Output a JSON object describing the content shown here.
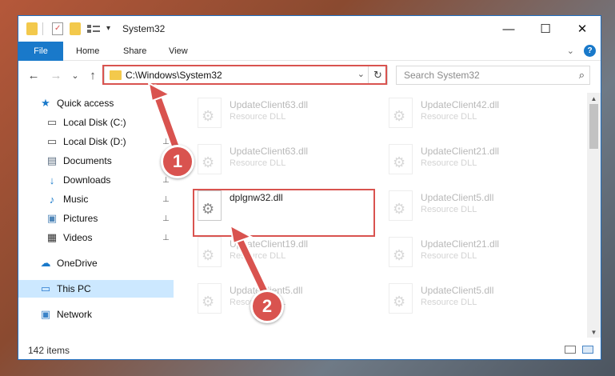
{
  "window": {
    "title": "System32",
    "controls": {
      "minimize": "—",
      "maximize": "☐",
      "close": "✕"
    }
  },
  "ribbon": {
    "tabs": [
      "File",
      "Home",
      "Share",
      "View"
    ],
    "expand_icon": "chevron-down-icon",
    "help_label": "?"
  },
  "navigation": {
    "back": "←",
    "forward": "→",
    "recent": "⌄",
    "up": "↑"
  },
  "address_bar": {
    "path": "C:\\Windows\\System32",
    "dropdown": "⌄",
    "refresh": "↻"
  },
  "search": {
    "placeholder": "Search System32",
    "icon": "⌕"
  },
  "sidebar": {
    "items": [
      {
        "label": "Quick access",
        "icon": "★",
        "icon_color": "#1979ca",
        "pinned": false
      },
      {
        "label": "Local Disk (C:)",
        "icon": "▭",
        "icon_color": "#4a4a4a",
        "pinned": false
      },
      {
        "label": "Local Disk (D:)",
        "icon": "▭",
        "icon_color": "#4a4a4a",
        "pinned": true
      },
      {
        "label": "Documents",
        "icon": "▤",
        "icon_color": "#5e6f83",
        "pinned": true
      },
      {
        "label": "Downloads",
        "icon": "↓",
        "icon_color": "#1979ca",
        "pinned": true
      },
      {
        "label": "Music",
        "icon": "♪",
        "icon_color": "#1979ca",
        "pinned": true
      },
      {
        "label": "Pictures",
        "icon": "▣",
        "icon_color": "#4f86b8",
        "pinned": true
      },
      {
        "label": "Videos",
        "icon": "▦",
        "icon_color": "#333333",
        "pinned": true
      },
      {
        "label": "OneDrive",
        "icon": "☁",
        "icon_color": "#1979ca",
        "pinned": false
      },
      {
        "label": "This PC",
        "icon": "▭",
        "icon_color": "#2b7bcf",
        "pinned": false
      },
      {
        "label": "Network",
        "icon": "▣",
        "icon_color": "#3b83c8",
        "pinned": false
      }
    ],
    "pin_glyph": "📌"
  },
  "files": [
    {
      "name": "UpdateClient63.dll",
      "type": "Resource DLL",
      "faded": true
    },
    {
      "name": "UpdateClient42.dll",
      "type": "Resource DLL",
      "faded": true
    },
    {
      "name": "UpdateClient63.dll",
      "type": "Resource DLL",
      "faded": true
    },
    {
      "name": "UpdateClient21.dll",
      "type": "Resource DLL",
      "faded": true
    },
    {
      "name": "dplgnw32.dll",
      "type": "",
      "faded": false
    },
    {
      "name": "UpdateClient5.dll",
      "type": "Resource DLL",
      "faded": true
    },
    {
      "name": "UpdateClient19.dll",
      "type": "Resource DLL",
      "faded": true
    },
    {
      "name": "UpdateClient21.dll",
      "type": "Resource DLL",
      "faded": true
    },
    {
      "name": "UpdateClient5.dll",
      "type": "Resource DLL",
      "faded": true
    },
    {
      "name": "UpdateClient5.dll",
      "type": "Resource DLL",
      "faded": true
    }
  ],
  "status": {
    "item_count": "142 items"
  },
  "annotations": {
    "step1": "1",
    "step2": "2",
    "color": "#d9534f"
  }
}
